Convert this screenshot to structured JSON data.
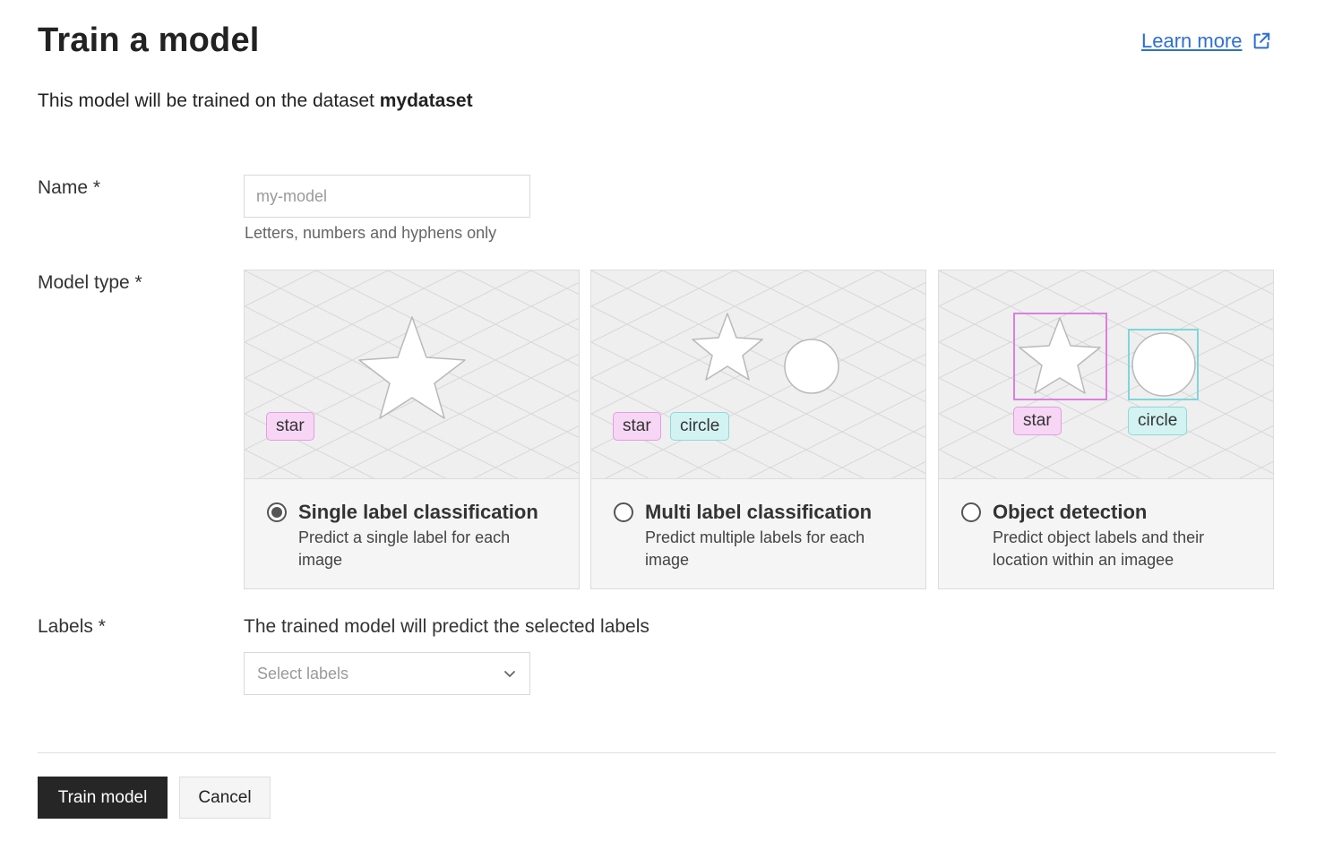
{
  "header": {
    "title": "Train a model",
    "learn_more": "Learn more"
  },
  "subtitle": {
    "prefix": "This model will be trained on the dataset ",
    "dataset": "mydataset"
  },
  "form": {
    "name": {
      "label": "Name *",
      "placeholder": "my-model",
      "hint": "Letters, numbers and hyphens only"
    },
    "model_type": {
      "label": "Model type *",
      "selected": "single",
      "options": [
        {
          "id": "single",
          "title": "Single label classification",
          "description": "Predict a single label for each image",
          "tags": [
            "star"
          ]
        },
        {
          "id": "multi",
          "title": "Multi label classification",
          "description": "Predict multiple labels for each image",
          "tags": [
            "star",
            "circle"
          ]
        },
        {
          "id": "detection",
          "title": "Object detection",
          "description": "Predict object labels and their location within an imagee",
          "tags": [
            "star",
            "circle"
          ]
        }
      ]
    },
    "labels": {
      "label": "Labels *",
      "help": "The trained model will predict the selected labels",
      "placeholder": "Select labels"
    }
  },
  "actions": {
    "train": "Train model",
    "cancel": "Cancel"
  },
  "colors": {
    "primary_button": "#262626",
    "link": "#2f6fd1",
    "star_tag_bg": "#f7d6f5",
    "star_tag_border": "#e19ee0",
    "circle_tag_bg": "#d2f3f2",
    "circle_tag_border": "#8fd9d6"
  }
}
